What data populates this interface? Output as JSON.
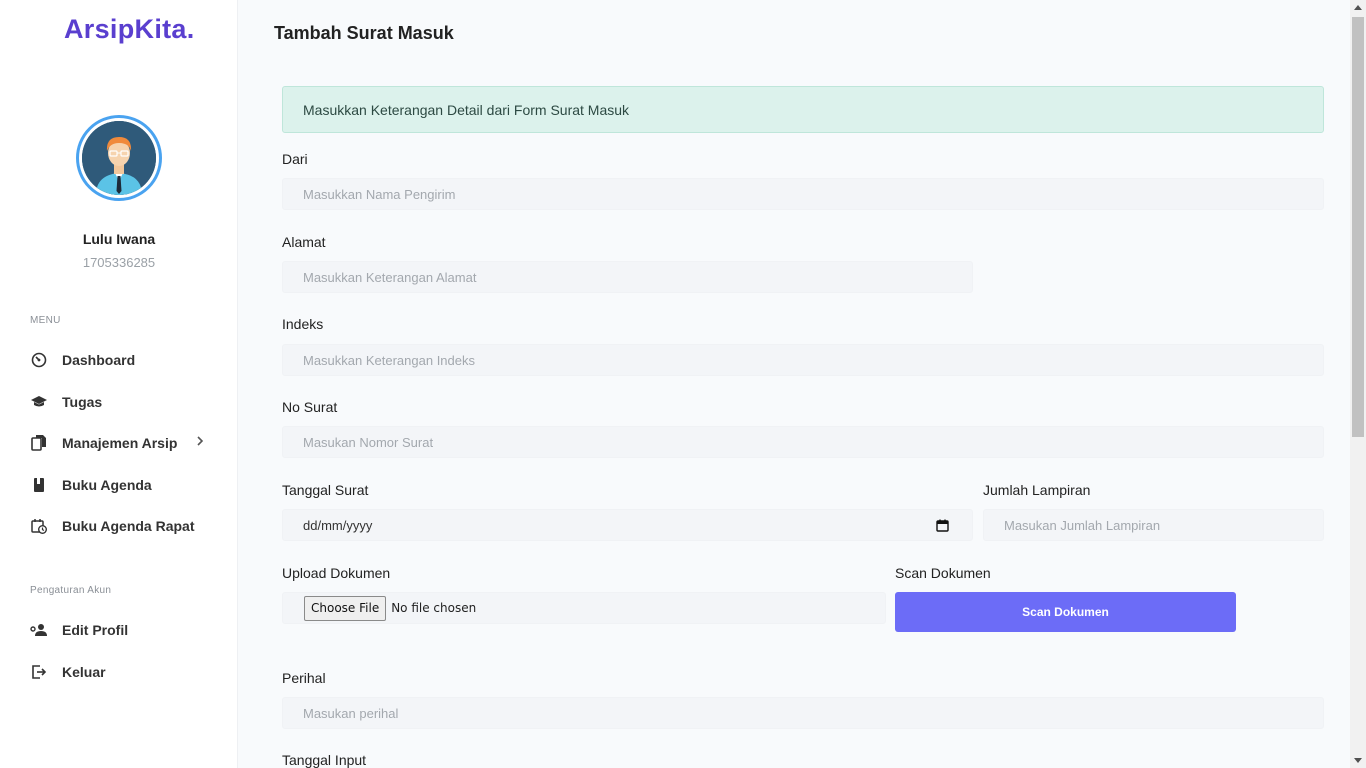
{
  "brand": {
    "name": "ArsipKita",
    "dot": "."
  },
  "user": {
    "name": "Lulu Iwana",
    "id": "1705336285"
  },
  "sidebar": {
    "menu_label": "MENU",
    "items": [
      {
        "label": "Dashboard",
        "icon": "dashboard-gauge-icon"
      },
      {
        "label": "Tugas",
        "icon": "graduation-cap-icon"
      },
      {
        "label": "Manajemen Arsip",
        "icon": "copy-documents-icon",
        "has_submenu": true
      },
      {
        "label": "Buku Agenda",
        "icon": "book-icon"
      },
      {
        "label": "Buku Agenda Rapat",
        "icon": "calendar-clock-icon"
      }
    ],
    "account_label": "Pengaturan Akun",
    "account_items": [
      {
        "label": "Edit Profil",
        "icon": "user-cog-icon"
      },
      {
        "label": "Keluar",
        "icon": "logout-icon"
      }
    ]
  },
  "page": {
    "title": "Tambah Surat Masuk",
    "alert": "Masukkan Keterangan Detail dari Form Surat Masuk"
  },
  "form": {
    "dari": {
      "label": "Dari",
      "placeholder": "Masukkan Nama Pengirim"
    },
    "alamat": {
      "label": "Alamat",
      "placeholder": "Masukkan Keterangan Alamat"
    },
    "indeks": {
      "label": "Indeks",
      "placeholder": "Masukkan Keterangan Indeks"
    },
    "no_surat": {
      "label": "No Surat",
      "placeholder": "Masukan Nomor Surat"
    },
    "tanggal_surat": {
      "label": "Tanggal Surat",
      "value": "dd/mm/yyyy"
    },
    "jumlah_lampiran": {
      "label": "Jumlah Lampiran",
      "placeholder": "Masukan Jumlah Lampiran"
    },
    "upload": {
      "label": "Upload Dokumen",
      "button": "Choose File",
      "status": "No file chosen"
    },
    "scan": {
      "label": "Scan Dokumen",
      "button": "Scan Dokumen"
    },
    "perihal": {
      "label": "Perihal",
      "placeholder": "Masukan perihal"
    },
    "tanggal_input": {
      "label": "Tanggal Input"
    }
  },
  "colors": {
    "brand": "#5a3fcf",
    "accent_button": "#6c6cf7",
    "alert_bg": "#dcf2ec"
  }
}
